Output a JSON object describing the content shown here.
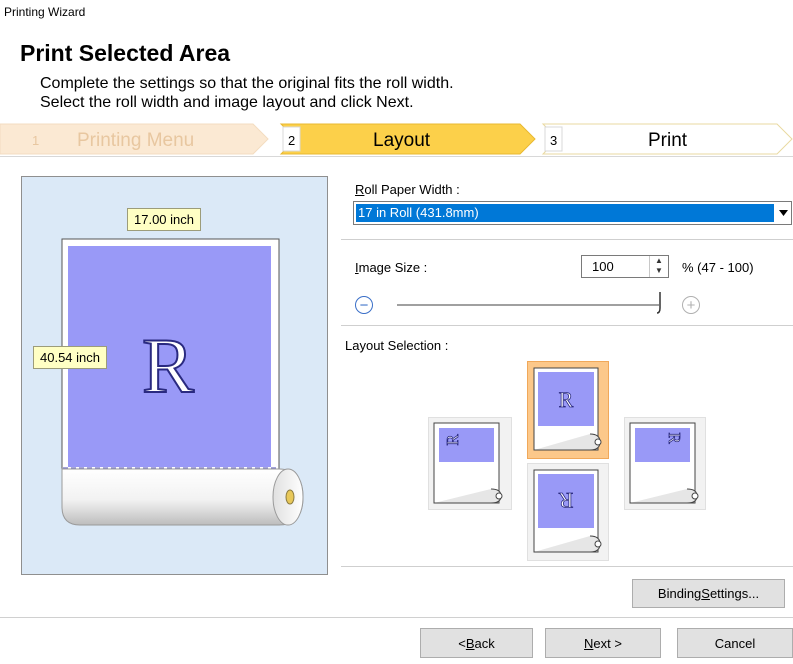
{
  "window_title": "Printing Wizard",
  "header": {
    "title": "Print Selected Area",
    "desc_line1": "Complete the settings so that the original fits the roll width.",
    "desc_line2": "Select the roll width and image layout and click Next."
  },
  "steps": [
    {
      "num": "1",
      "label": "Printing Menu",
      "state": "done"
    },
    {
      "num": "2",
      "label": "Layout",
      "state": "active"
    },
    {
      "num": "3",
      "label": "Print",
      "state": "pending"
    }
  ],
  "preview": {
    "width_label": "17.00 inch",
    "height_label": "40.54 inch",
    "letter": "R"
  },
  "roll_paper": {
    "label_key": "R",
    "label_rest": "oll Paper Width :",
    "selected": "17 in Roll (431.8mm)"
  },
  "image_size": {
    "label_key": "I",
    "label_rest": "mage Size :",
    "value": "100",
    "range": "% (47 - 100)",
    "slider_fraction": 1.0
  },
  "layout_selection": {
    "label": "Layout Selection :",
    "options": [
      {
        "name": "rotate-left",
        "glyph": "R"
      },
      {
        "name": "normal",
        "glyph": "R"
      },
      {
        "name": "rotate-right",
        "glyph": "R"
      },
      {
        "name": "rotate-180",
        "glyph": "R"
      }
    ],
    "selected": "normal"
  },
  "buttons": {
    "binding_pre": "Binding ",
    "binding_key": "S",
    "binding_post": "ettings...",
    "back_pre": "< ",
    "back_key": "B",
    "back_post": "ack",
    "next_key": "N",
    "next_post": "ext >",
    "cancel": "Cancel"
  },
  "colors": {
    "accent_orange": "#fcd04a",
    "selection_blue": "#0078d7",
    "paper_purple": "#9999f7",
    "preview_bg": "#dbe9f7",
    "callout_yellow": "#ffffc4"
  }
}
